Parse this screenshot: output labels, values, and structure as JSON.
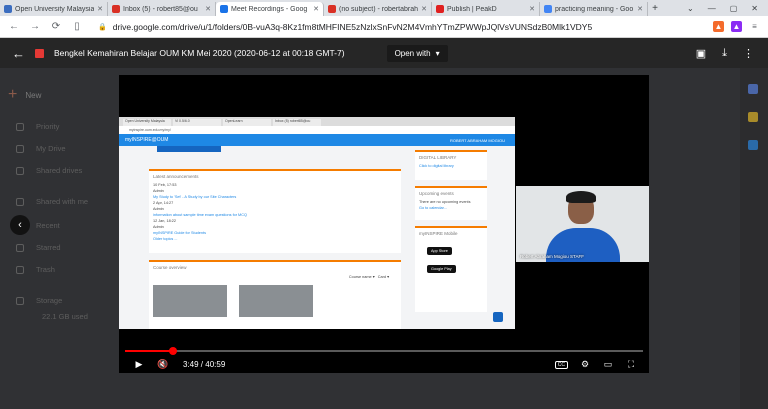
{
  "browser": {
    "tabs": [
      {
        "title": "Open University Malaysia",
        "color": "#3b6dbf",
        "active": false
      },
      {
        "title": "Inbox (5) - robert85@ou",
        "color": "#d93025",
        "active": false
      },
      {
        "title": "Meet Recordings - Goog",
        "color": "#1a73e8",
        "active": true
      },
      {
        "title": "(no subject) - robertabrah",
        "color": "#d93025",
        "active": false
      },
      {
        "title": "Publish | PeakD",
        "color": "#e02020",
        "active": false
      },
      {
        "title": "practicing meaning - Goo",
        "color": "#4285f4",
        "active": false
      }
    ],
    "new_tab": "+",
    "window_controls": [
      "⌄",
      "—",
      "▢",
      "✕"
    ],
    "url": "drive.google.com/drive/u/1/folders/0B-vuA3q-8Kz1fm8tMHFINE5zNzlxSnFvN2M4VmhYTmZPWWpJQlVsVUNSdzB0Mlk1VDY5SUU"
  },
  "viewer": {
    "title": "Bengkel Kemahiran Belajar OUM KM Mei 2020 (2020-06-12 at 00:18 GMT-7)",
    "open_with": "Open with",
    "back_icon": "arrow-left-icon",
    "top_icons": [
      "add-comment-icon",
      "download-icon",
      "more-vert-icon"
    ]
  },
  "sidebar": {
    "new_label": "New",
    "items": [
      "Priority",
      "My Drive",
      "Shared drives",
      "Shared with me",
      "Recent",
      "Starred",
      "Trash",
      "Storage"
    ],
    "storage_text": "22.1 GB used"
  },
  "shared_screen": {
    "header_title": "myINSPIRE@OUM",
    "header_user": "ROBERT ABRAHAM MOGIOU",
    "announce_title": "Latest announcements",
    "announce_lines": [
      "10 Feb, 17:53",
      "Admin",
      "My Study to 'Set' - A Study by our Site Characters",
      "2 Apr, 14:27",
      "Admin",
      "information about sample time exam questions for MCQ",
      "12 Jan, 18:22",
      "Admin",
      "myINSPIRE Guide for Students",
      "Older topics ..."
    ],
    "course_overview": "Course overview",
    "sort_label": "Course name",
    "view_label": "Card",
    "digital_library": "DIGITAL LIBRARY",
    "digital_link": "Click to digital library",
    "upcoming": "Upcoming events",
    "upcoming_text": "There are no upcoming events",
    "goto_calendar": "Go to calendar...",
    "mobile": "myINSPIRE Mobile",
    "app_store": "App Store",
    "google_play": "Google Play"
  },
  "camera": {
    "label": "Robert Abraham Mogiou STAFF"
  },
  "playback": {
    "current": "3:49",
    "separator": " / ",
    "duration": "40:59",
    "progress_fraction": 0.093
  }
}
